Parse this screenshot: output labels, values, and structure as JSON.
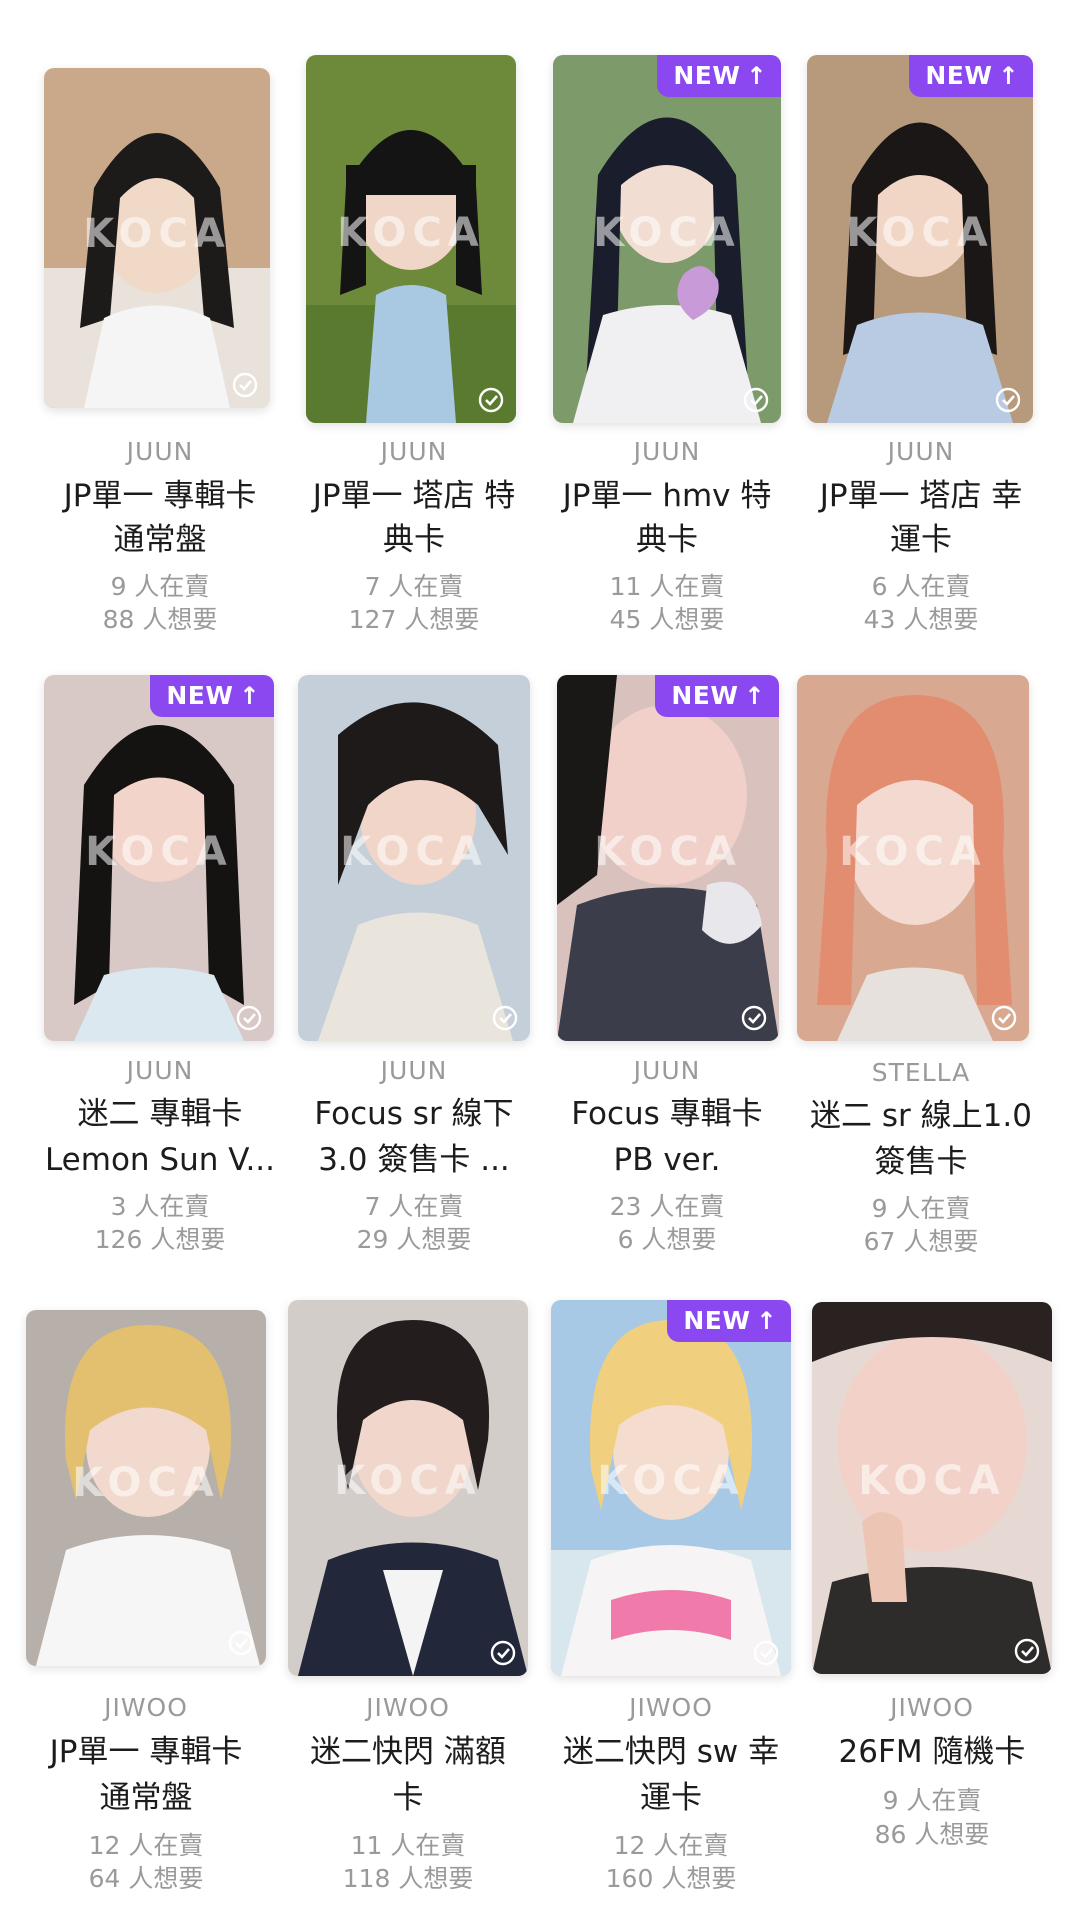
{
  "badge": {
    "new_label": "NEW",
    "arrow": "↑"
  },
  "watermark": "KOCA",
  "colors": {
    "badge": "#8b47f0",
    "muted_text": "#9a9a9a",
    "title_text": "#1c1c1c"
  },
  "cards": [
    {
      "member": "JUUN",
      "title_line1": "JP單一 專輯卡",
      "title_line2": "通常盤",
      "selling": "9 人在賣",
      "wanted": "88 人想要",
      "is_new": false
    },
    {
      "member": "JUUN",
      "title_line1": "JP單一 塔店 特",
      "title_line2": "典卡",
      "selling": "7 人在賣",
      "wanted": "127 人想要",
      "is_new": false
    },
    {
      "member": "JUUN",
      "title_line1": "JP單一 hmv 特",
      "title_line2": "典卡",
      "selling": "11 人在賣",
      "wanted": "45 人想要",
      "is_new": true
    },
    {
      "member": "JUUN",
      "title_line1": "JP單一 塔店 幸",
      "title_line2": "運卡",
      "selling": "6 人在賣",
      "wanted": "43 人想要",
      "is_new": true
    },
    {
      "member": "JUUN",
      "title_line1": "迷二 專輯卡",
      "title_line2": "Lemon Sun V...",
      "selling": "3 人在賣",
      "wanted": "126 人想要",
      "is_new": true
    },
    {
      "member": "JUUN",
      "title_line1": "Focus sr 線下",
      "title_line2": "3.0 簽售卡 ...",
      "selling": "7 人在賣",
      "wanted": "29 人想要",
      "is_new": false
    },
    {
      "member": "JUUN",
      "title_line1": "Focus 專輯卡",
      "title_line2": "PB ver.",
      "selling": "23 人在賣",
      "wanted": "6 人想要",
      "is_new": true
    },
    {
      "member": "STELLA",
      "title_line1": "迷二 sr 線上1.0",
      "title_line2": "簽售卡",
      "selling": "9 人在賣",
      "wanted": "67 人想要",
      "is_new": false
    },
    {
      "member": "JIWOO",
      "title_line1": "JP單一 專輯卡",
      "title_line2": "通常盤",
      "selling": "12 人在賣",
      "wanted": "64 人想要",
      "is_new": false
    },
    {
      "member": "JIWOO",
      "title_line1": "迷二快閃 滿額",
      "title_line2": "卡",
      "selling": "11 人在賣",
      "wanted": "118 人想要",
      "is_new": false
    },
    {
      "member": "JIWOO",
      "title_line1": "迷二快閃 sw 幸",
      "title_line2": "運卡",
      "selling": "12 人在賣",
      "wanted": "160 人想要",
      "is_new": true
    },
    {
      "member": "JIWOO",
      "title_line1": "26FM 隨機卡",
      "title_line2": "",
      "selling": "9 人在賣",
      "wanted": "86 人想要",
      "is_new": false
    }
  ]
}
